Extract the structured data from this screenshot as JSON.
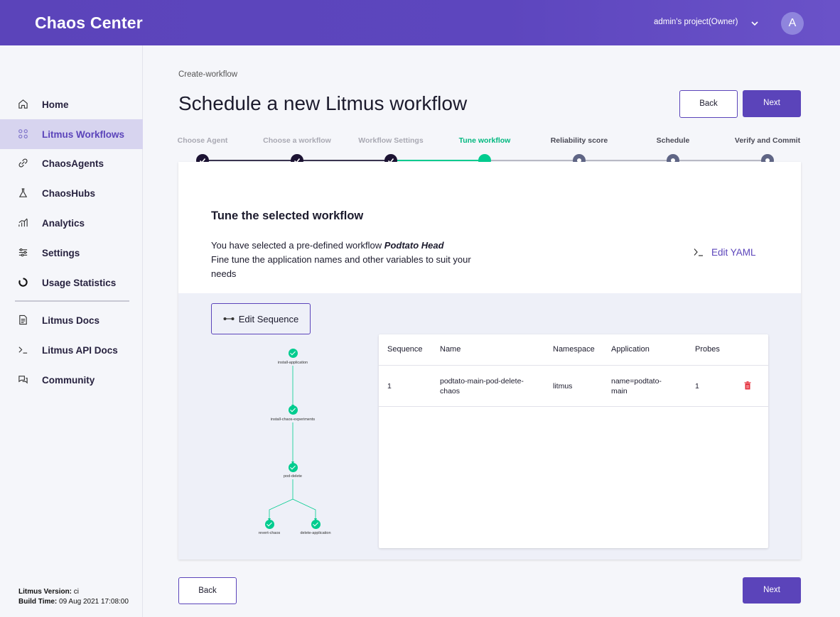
{
  "app": {
    "title": "Chaos Center"
  },
  "header": {
    "project": "admin's project(Owner)",
    "avatar_initial": "A"
  },
  "sidebar": {
    "items": [
      {
        "label": "Home",
        "icon": "home-icon"
      },
      {
        "label": "Litmus Workflows",
        "icon": "workflows-icon",
        "active": true
      },
      {
        "label": "ChaosAgents",
        "icon": "link-icon"
      },
      {
        "label": "ChaosHubs",
        "icon": "flask-icon"
      },
      {
        "label": "Analytics",
        "icon": "analytics-icon"
      },
      {
        "label": "Settings",
        "icon": "settings-sliders-icon"
      },
      {
        "label": "Usage Statistics",
        "icon": "usage-ring-icon"
      },
      {
        "label": "Litmus Docs",
        "icon": "document-icon"
      },
      {
        "label": "Litmus API Docs",
        "icon": "terminal-icon"
      },
      {
        "label": "Community",
        "icon": "chat-icon"
      }
    ],
    "version_label": "Litmus Version:",
    "version_value": " ci",
    "build_label": "Build Time:",
    "build_value": " 09 Aug 2021 17:08:00"
  },
  "page": {
    "breadcrumb": "Create-workflow",
    "title": "Schedule a new Litmus workflow",
    "back_label": "Back",
    "next_label": "Next"
  },
  "stepper": {
    "steps": [
      {
        "label": "Choose Agent",
        "state": "done"
      },
      {
        "label": "Choose a workflow",
        "state": "done"
      },
      {
        "label": "Workflow Settings",
        "state": "done"
      },
      {
        "label": "Tune workflow",
        "state": "active"
      },
      {
        "label": "Reliability score",
        "state": "upcoming"
      },
      {
        "label": "Schedule",
        "state": "upcoming"
      },
      {
        "label": "Verify and Commit",
        "state": "upcoming"
      }
    ]
  },
  "tune": {
    "heading": "Tune the selected workflow",
    "desc_prefix": "You have selected a pre-defined workflow ",
    "workflow_name": "Podtato Head",
    "desc_rest": "Fine tune the application names and other variables to suit your needs",
    "edit_yaml_label": "Edit YAML",
    "edit_sequence_label": "Edit Sequence"
  },
  "graph": {
    "nodes": [
      "install-application",
      "install-chaos-experiments",
      "pod-delete",
      "revert-chaos",
      "delete-application"
    ]
  },
  "table": {
    "headers": [
      "Sequence",
      "Name",
      "Namespace",
      "Application",
      "Probes"
    ],
    "rows": [
      {
        "sequence": "1",
        "name": "podtato-main-pod-delete-chaos",
        "namespace": "litmus",
        "application": "name=podtato-main",
        "probes": "1"
      }
    ]
  },
  "footer": {
    "back_label": "Back",
    "next_label": "Next"
  },
  "colors": {
    "brand": "#5b44ba",
    "success": "#00cc8f",
    "danger": "#e5303d"
  }
}
